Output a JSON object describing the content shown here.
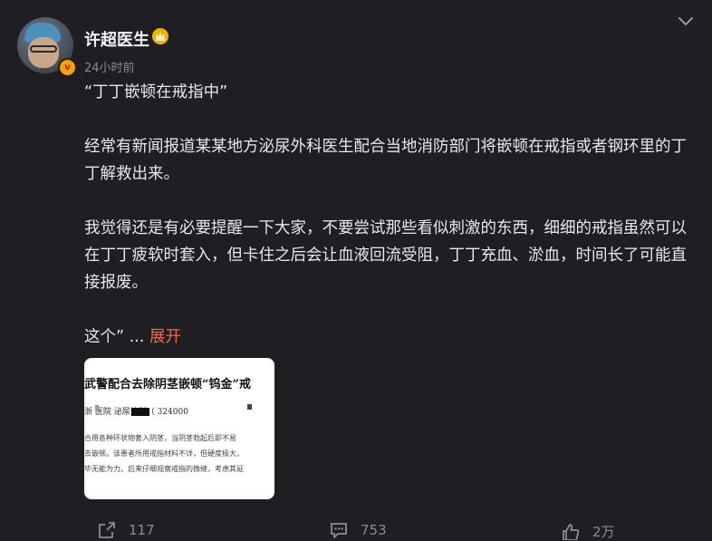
{
  "author": {
    "name": "许超医生",
    "verified_badge": "v",
    "crown_icon": "crown-icon"
  },
  "post": {
    "time": "24小时前",
    "paragraphs": [
      "“丁丁嵌顿在戒指中”",
      "经常有新闻报道某某地方泌尿外科医生配合当地消防部门将嵌顿在戒指或者钢环里的丁丁解救出来。",
      "我觉得还是有必要提醒一下大家，不要尝试那些看似刺激的东西，细细的戒指虽然可以在丁丁疲软时套入，但卡住之后会让血液回流受阻，丁丁充血、淤血，时间长了可能直接报废。"
    ],
    "last_text": "这个”",
    "ellipsis": "...",
    "expand_label": "展开"
  },
  "media": {
    "line1": "武警配合去除阴茎嵌顿“钨金”戒",
    "line2": "浙          医院  泌尿外科（ 324000",
    "body_lines": [
      "合用各种环状物套入阴茎，当阴茎勃起后即不易",
      "去嵌顿。该患者所用戒指材料不详，但硬度极大，",
      "毕无能为力。后来仔细观察戒指的微缝，考虑其延"
    ]
  },
  "actions": {
    "share_count": "117",
    "comment_count": "753",
    "like_count": "2万"
  }
}
